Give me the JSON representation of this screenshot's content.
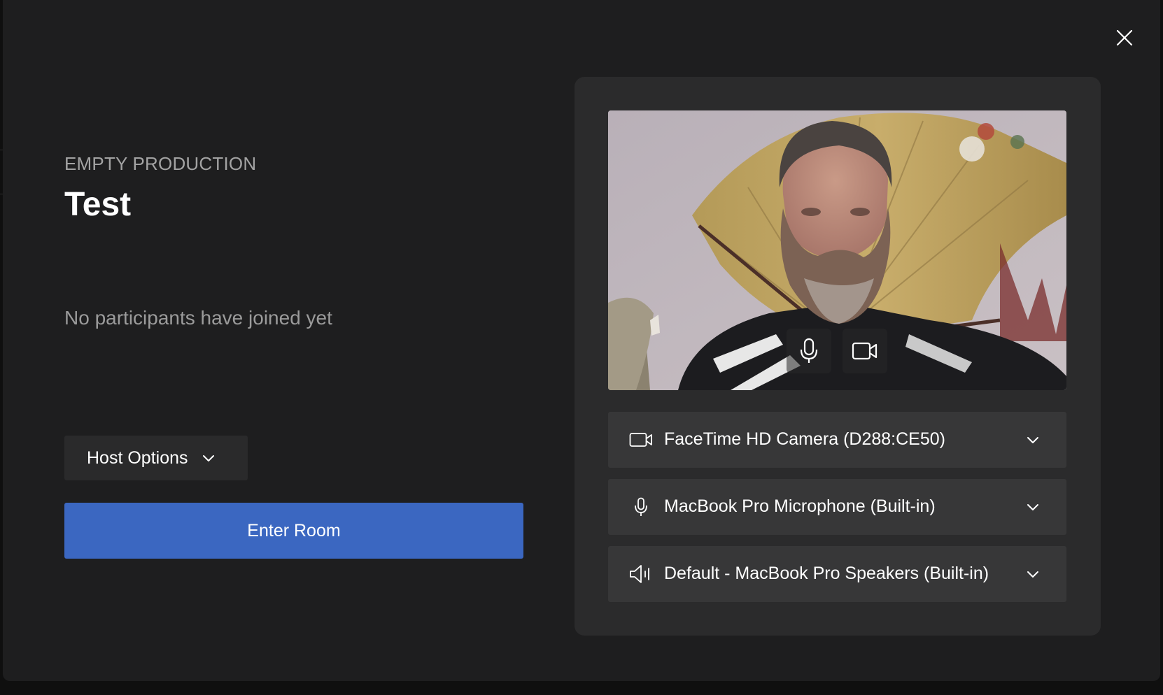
{
  "dialog": {
    "close_icon": "close-icon",
    "production_label": "EMPTY PRODUCTION",
    "room_title": "Test",
    "participants_status": "No participants have joined yet",
    "host_options_label": "Host Options",
    "enter_room_label": "Enter Room",
    "accent_color": "#3b67c1"
  },
  "preview": {
    "mic_button_icon": "microphone-icon",
    "camera_button_icon": "video-camera-icon"
  },
  "devices": {
    "camera": {
      "icon": "video-camera-icon",
      "label": "FaceTime HD Camera (D288:CE50)"
    },
    "microphone": {
      "icon": "microphone-icon",
      "label": "MacBook Pro Microphone (Built-in)"
    },
    "speaker": {
      "icon": "speaker-icon",
      "label": "Default - MacBook Pro Speakers (Built-in)"
    }
  }
}
